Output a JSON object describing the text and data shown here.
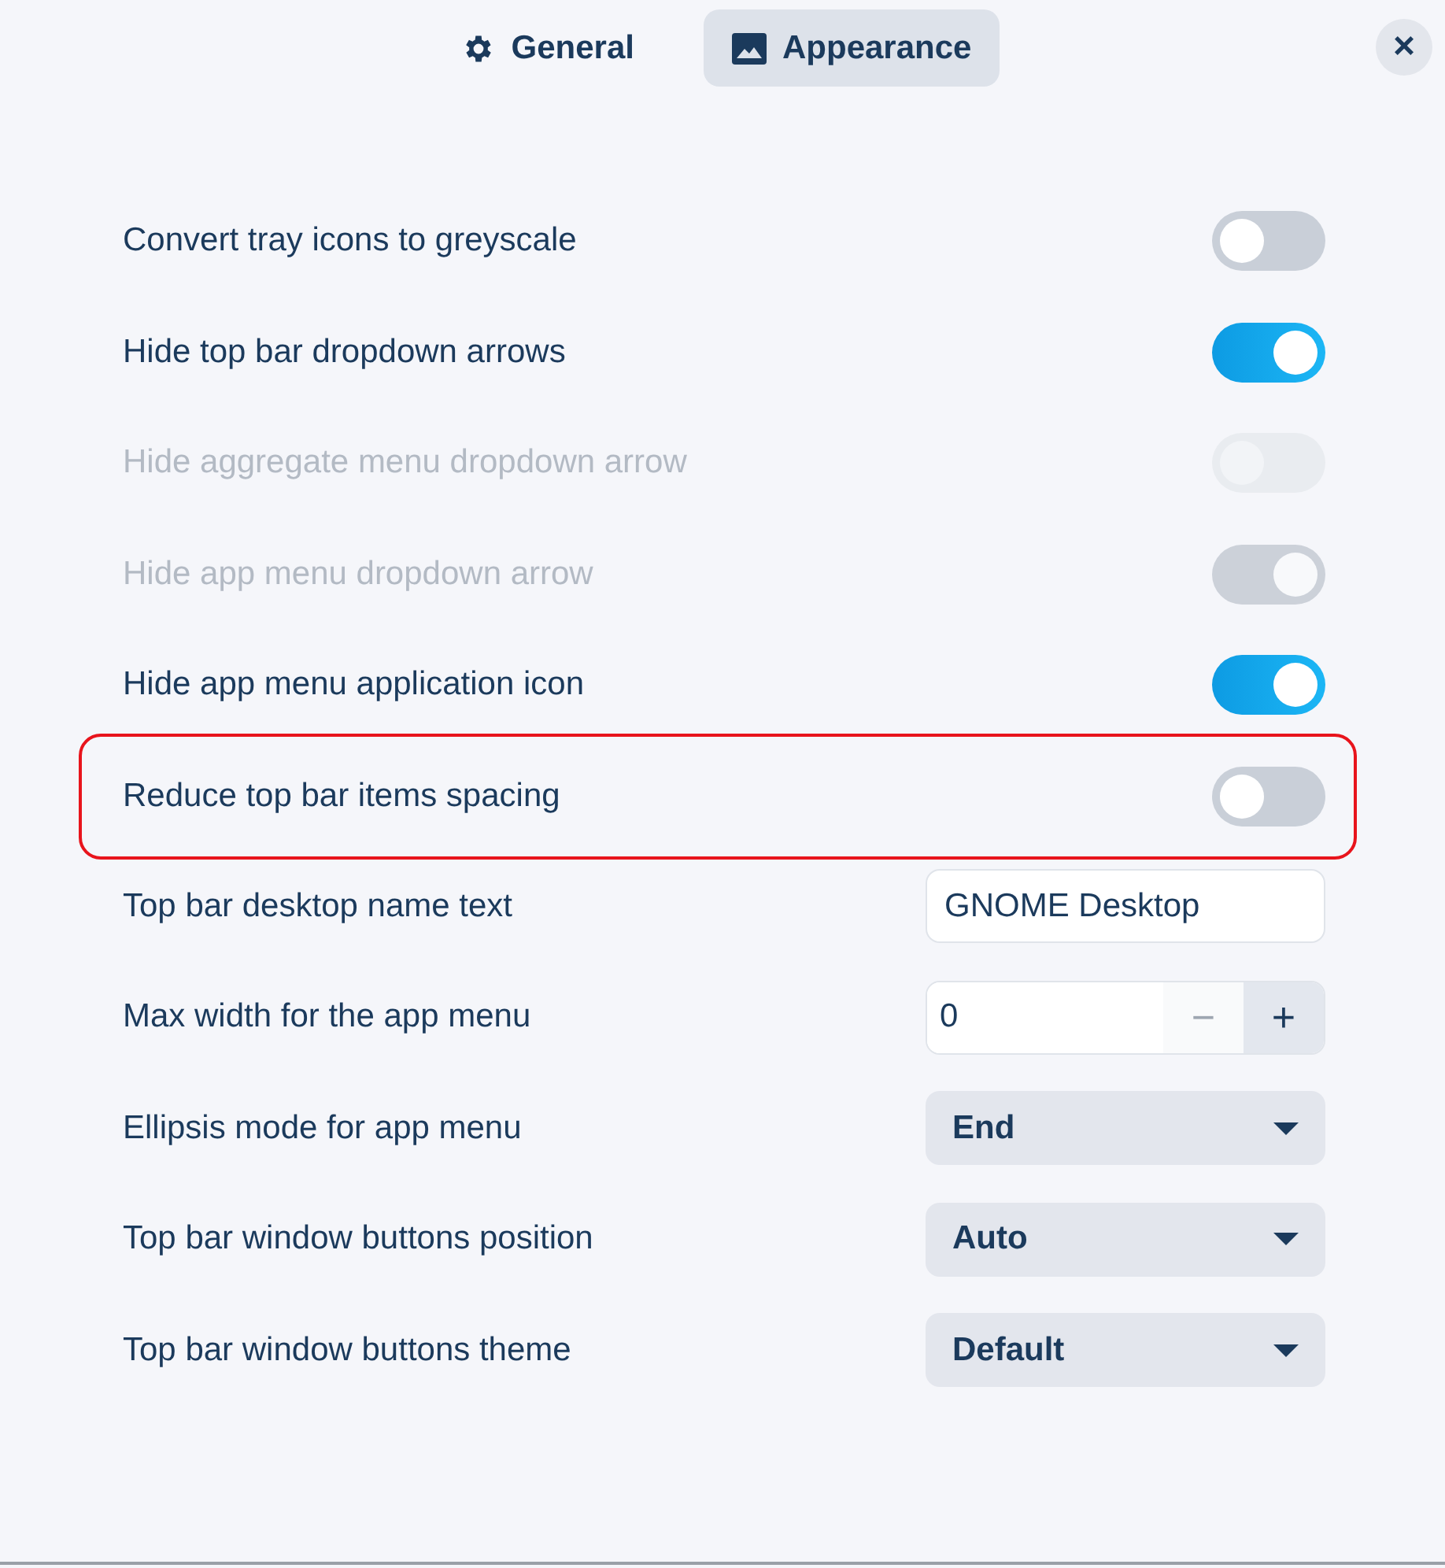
{
  "tabs": [
    {
      "label": "General",
      "kind": "gear",
      "selected": false
    },
    {
      "label": "Appearance",
      "kind": "image",
      "selected": true
    }
  ],
  "rows": [
    {
      "kind": "switch",
      "label": "Convert tray icons to greyscale",
      "on": false,
      "disabled": false,
      "highlighted": false
    },
    {
      "kind": "switch",
      "label": "Hide top bar dropdown arrows",
      "on": true,
      "disabled": false,
      "highlighted": false
    },
    {
      "kind": "switch",
      "label": "Hide aggregate menu dropdown arrow",
      "on": false,
      "disabled": true,
      "highlighted": false
    },
    {
      "kind": "switch",
      "label": "Hide app menu dropdown arrow",
      "on": true,
      "disabled": true,
      "highlighted": false
    },
    {
      "kind": "switch",
      "label": "Hide app menu application icon",
      "on": true,
      "disabled": false,
      "highlighted": false
    },
    {
      "kind": "switch",
      "label": "Reduce top bar items spacing",
      "on": false,
      "disabled": false,
      "highlighted": true
    },
    {
      "kind": "text",
      "label": "Top bar desktop name text",
      "value": "GNOME Desktop",
      "highlighted": false
    },
    {
      "kind": "spin",
      "label": "Max width for the app menu",
      "value": "0",
      "minus_disabled": true,
      "plus_disabled": false,
      "minus": "−",
      "plus": "+",
      "highlighted": false
    },
    {
      "kind": "dropdown",
      "label": "Ellipsis mode for app menu",
      "value": "End",
      "highlighted": false
    },
    {
      "kind": "dropdown",
      "label": "Top bar window buttons position",
      "value": "Auto",
      "highlighted": false
    },
    {
      "kind": "dropdown",
      "label": "Top bar window buttons theme",
      "value": "Default",
      "highlighted": false
    }
  ],
  "close": "×"
}
